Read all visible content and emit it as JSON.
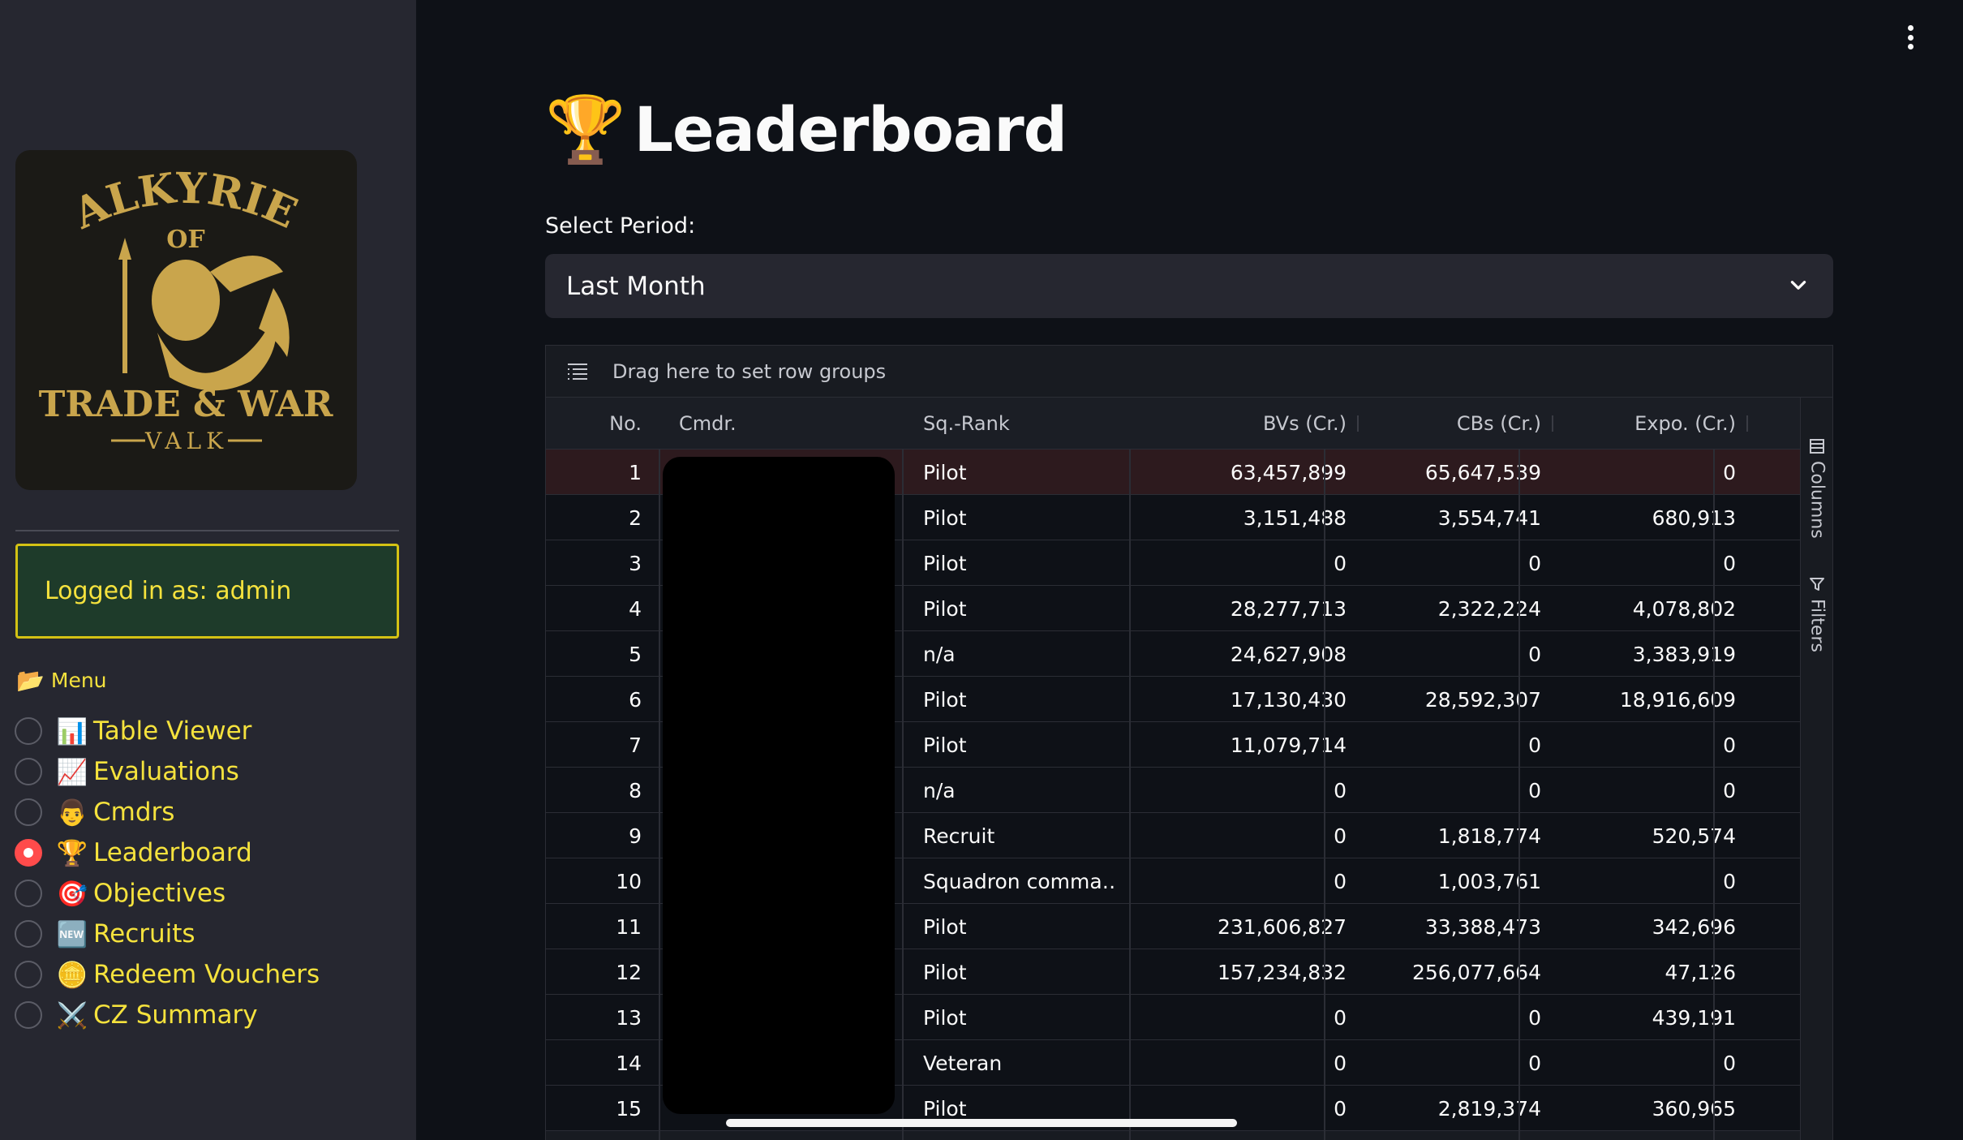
{
  "sidebar": {
    "logo": {
      "line1": "VALKYRIES",
      "line2": "OF",
      "line3": "TRADE & WAR",
      "line4": "VALK"
    },
    "logged_in": "Logged in as: admin",
    "menu_title": "Menu",
    "menu_icon": "folder-icon",
    "items": [
      {
        "label": "Table Viewer",
        "icon": "📊",
        "selected": false
      },
      {
        "label": "Evaluations",
        "icon": "📈",
        "selected": false
      },
      {
        "label": "Cmdrs",
        "icon": "👨",
        "selected": false
      },
      {
        "label": "Leaderboard",
        "icon": "🏆",
        "selected": true
      },
      {
        "label": "Objectives",
        "icon": "🎯",
        "selected": false
      },
      {
        "label": "Recruits",
        "icon": "🆕",
        "selected": false
      },
      {
        "label": "Redeem Vouchers",
        "icon": "🪙",
        "selected": false
      },
      {
        "label": "CZ Summary",
        "icon": "⚔️",
        "selected": false
      }
    ]
  },
  "header": {
    "title": "Leaderboard",
    "title_icon": "🏆"
  },
  "period": {
    "label": "Select Period:",
    "value": "Last Month"
  },
  "grid": {
    "group_hint": "Drag here to set row groups",
    "columns": [
      "No.",
      "Cmdr.",
      "Sq.-Rank",
      "BVs (Cr.)",
      "CBs (Cr.)",
      "Expo. (Cr.)"
    ],
    "side_buttons": [
      "Columns",
      "Filters"
    ],
    "rows": [
      {
        "no": "1",
        "rank": "Pilot",
        "bvs": "63,457,899",
        "cbs": "65,647,539",
        "expo": "0"
      },
      {
        "no": "2",
        "rank": "Pilot",
        "bvs": "3,151,488",
        "cbs": "3,554,741",
        "expo": "680,913"
      },
      {
        "no": "3",
        "rank": "Pilot",
        "bvs": "0",
        "cbs": "0",
        "expo": "0"
      },
      {
        "no": "4",
        "rank": "Pilot",
        "bvs": "28,277,713",
        "cbs": "2,322,224",
        "expo": "4,078,802"
      },
      {
        "no": "5",
        "rank": "n/a",
        "bvs": "24,627,908",
        "cbs": "0",
        "expo": "3,383,919"
      },
      {
        "no": "6",
        "rank": "Pilot",
        "bvs": "17,130,430",
        "cbs": "28,592,307",
        "expo": "18,916,609"
      },
      {
        "no": "7",
        "rank": "Pilot",
        "bvs": "11,079,714",
        "cbs": "0",
        "expo": "0"
      },
      {
        "no": "8",
        "rank": "n/a",
        "bvs": "0",
        "cbs": "0",
        "expo": "0"
      },
      {
        "no": "9",
        "rank": "Recruit",
        "bvs": "0",
        "cbs": "1,818,774",
        "expo": "520,574"
      },
      {
        "no": "10",
        "rank": "Squadron comma…",
        "bvs": "0",
        "cbs": "1,003,761",
        "expo": "0"
      },
      {
        "no": "11",
        "rank": "Pilot",
        "bvs": "231,606,827",
        "cbs": "33,388,473",
        "expo": "342,696"
      },
      {
        "no": "12",
        "rank": "Pilot",
        "bvs": "157,234,832",
        "cbs": "256,077,664",
        "expo": "47,126"
      },
      {
        "no": "13",
        "rank": "Pilot",
        "bvs": "0",
        "cbs": "0",
        "expo": "439,191"
      },
      {
        "no": "14",
        "rank": "Veteran",
        "bvs": "0",
        "cbs": "0",
        "expo": "0"
      },
      {
        "no": "15",
        "rank": "Pilot",
        "bvs": "0",
        "cbs": "2,819,374",
        "expo": "360,965"
      }
    ]
  },
  "colors": {
    "accent": "#f5e23d",
    "selected_radio": "#ff4b4b",
    "sidebar_bg": "#262730",
    "main_bg": "#0e1117"
  }
}
